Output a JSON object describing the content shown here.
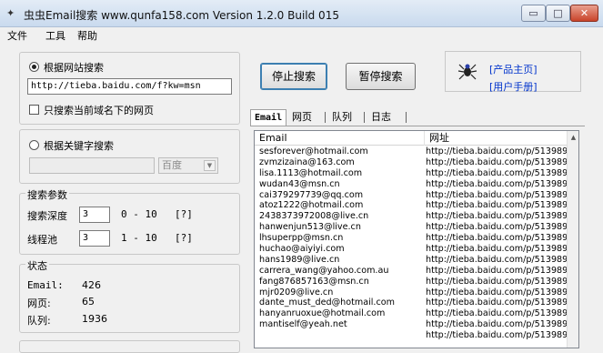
{
  "window": {
    "title": "虫虫Email搜索 www.qunfa158.com Version 1.2.0 Build 015",
    "min_glyph": "▭",
    "max_glyph": "□",
    "close_glyph": "✕"
  },
  "menu": [
    "文件",
    "工具",
    "帮助"
  ],
  "website_search": {
    "radio_label": "根据网站搜索",
    "url_value": "http://tieba.baidu.com/f?kw=msn",
    "domain_only_label": "只搜索当前域名下的网页"
  },
  "keyword_search": {
    "radio_label": "根据关键字搜索",
    "keyword_value": "",
    "engine_value": "百度"
  },
  "params": {
    "title": "搜索参数",
    "depth_label": "搜索深度",
    "depth_value": "3",
    "depth_range": "0 - 10",
    "depth_help": "[?]",
    "threads_label": "线程池",
    "threads_value": "3",
    "threads_range": "1 - 10",
    "threads_help": "[?]"
  },
  "status": {
    "title": "状态",
    "email_label": "Email:",
    "email_value": "426",
    "pages_label": "网页:",
    "pages_value": "65",
    "queue_label": "队列:",
    "queue_value": "1936"
  },
  "buttons": {
    "stop": "停止搜索",
    "pause": "暂停搜索"
  },
  "links": {
    "homepage": "[产品主页]",
    "manual": "[用户手册]"
  },
  "tabs": [
    "Email",
    "网页",
    "队列",
    "日志"
  ],
  "table": {
    "columns": [
      "Email",
      "网址"
    ],
    "rows": [
      [
        "sesforever@hotmail.com",
        "http://tieba.baidu.com/p/513989"
      ],
      [
        "zvmzizaina@163.com",
        "http://tieba.baidu.com/p/513989"
      ],
      [
        "lisa.1113@hotmail.com",
        "http://tieba.baidu.com/p/513989"
      ],
      [
        "wudan43@msn.cn",
        "http://tieba.baidu.com/p/513989"
      ],
      [
        "cai379297739@qq.com",
        "http://tieba.baidu.com/p/513989"
      ],
      [
        "atoz1222@hotmail.com",
        "http://tieba.baidu.com/p/513989"
      ],
      [
        "2438373972008@live.cn",
        "http://tieba.baidu.com/p/513989"
      ],
      [
        "hanwenjun513@live.cn",
        "http://tieba.baidu.com/p/513989"
      ],
      [
        "lhsuperpp@msn.cn",
        "http://tieba.baidu.com/p/513989"
      ],
      [
        "huchao@aiyiyi.com",
        "http://tieba.baidu.com/p/513989"
      ],
      [
        "hans1989@live.cn",
        "http://tieba.baidu.com/p/513989"
      ],
      [
        "carrera_wang@yahoo.com.au",
        "http://tieba.baidu.com/p/513989"
      ],
      [
        "fang876857163@msn.cn",
        "http://tieba.baidu.com/p/513989"
      ],
      [
        "mjr0209@live.cn",
        "http://tieba.baidu.com/p/513989"
      ],
      [
        "dante_must_ded@hotmail.com",
        "http://tieba.baidu.com/p/513989"
      ],
      [
        "hanyanruoxue@hotmail.com",
        "http://tieba.baidu.com/p/513989"
      ],
      [
        "mantiself@yeah.net",
        "http://tieba.baidu.com/p/513989"
      ],
      [
        "",
        "http://tieba.baidu.com/p/513989"
      ]
    ]
  },
  "icons": {
    "app": "bug-icon",
    "logo": "spider-icon"
  }
}
